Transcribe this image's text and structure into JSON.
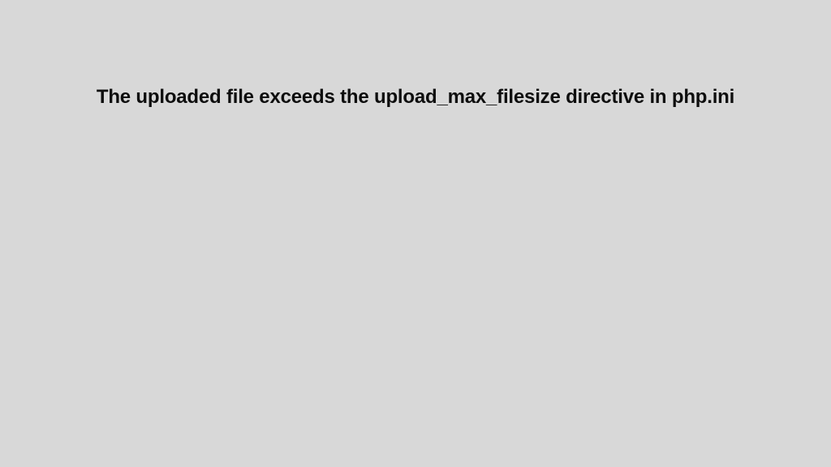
{
  "error": {
    "message": "The uploaded file exceeds the upload_max_filesize directive in php.ini"
  }
}
